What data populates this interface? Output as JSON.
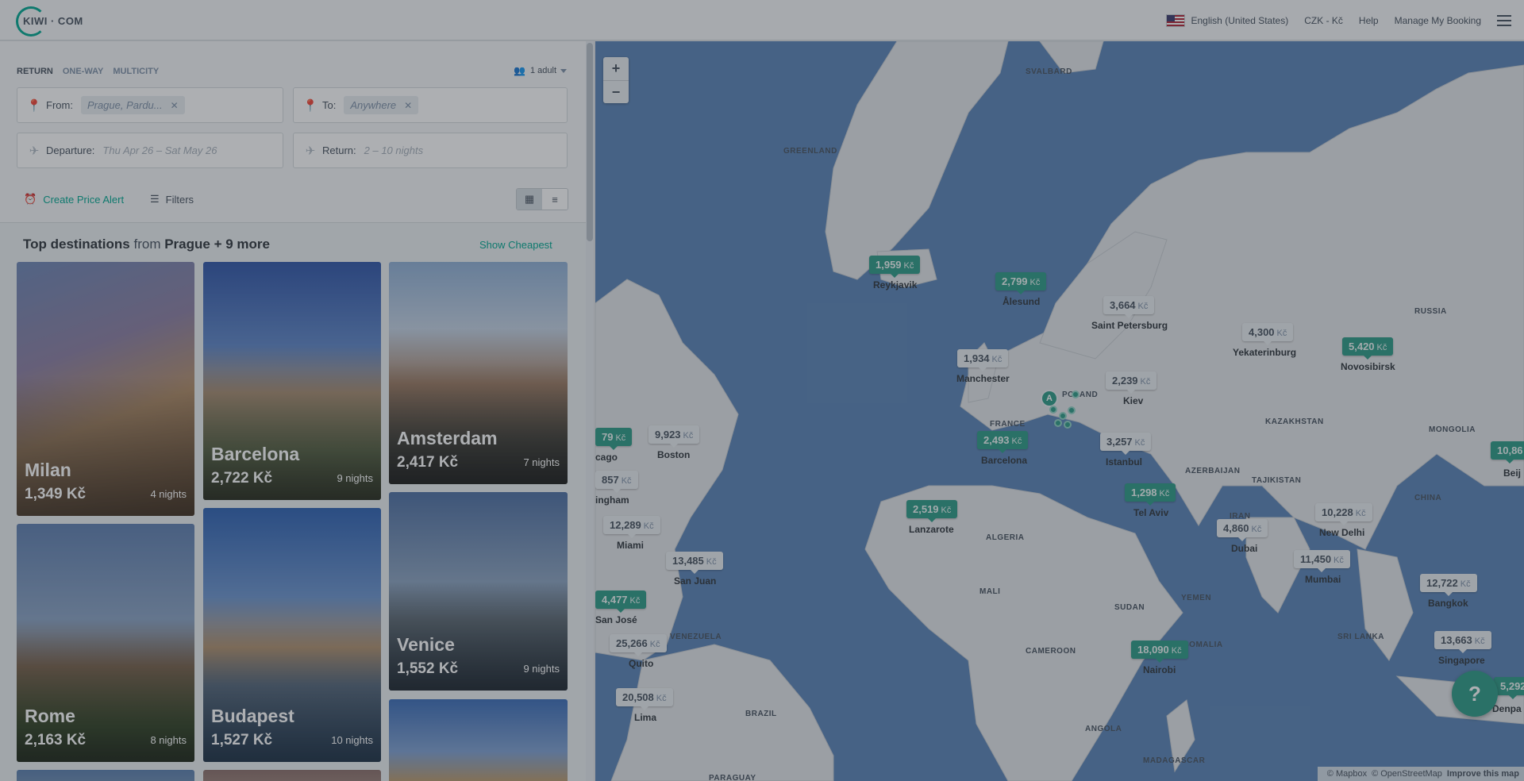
{
  "header": {
    "logo": "KIWI · COM",
    "language": "English (United States)",
    "currency": "CZK - Kč",
    "help": "Help",
    "manage_booking": "Manage My Booking"
  },
  "search": {
    "trip_types": [
      "RETURN",
      "ONE-WAY",
      "MULTICITY"
    ],
    "active_trip_type": "RETURN",
    "passengers": "1 adult",
    "from_label": "From:",
    "from_value": "Prague, Pardu...",
    "to_label": "To:",
    "to_value": "Anywhere",
    "departure_label": "Departure:",
    "departure_value": "Thu Apr 26 – Sat May 26",
    "return_label": "Return:",
    "return_value": "2 – 10 nights",
    "price_alert": "Create Price Alert",
    "filters": "Filters"
  },
  "destinations": {
    "heading_bold": "Top destinations",
    "heading_from": "from",
    "heading_origin": "Prague + 9 more",
    "show_cheapest": "Show Cheapest",
    "cards": [
      {
        "city": "Milan",
        "price": "1,349 Kč",
        "nights": "4 nights"
      },
      {
        "city": "Barcelona",
        "price": "2,722 Kč",
        "nights": "9 nights"
      },
      {
        "city": "Amsterdam",
        "price": "2,417 Kč",
        "nights": "7 nights"
      },
      {
        "city": "Rome",
        "price": "2,163 Kč",
        "nights": "8 nights"
      },
      {
        "city": "Budapest",
        "price": "1,527 Kč",
        "nights": "10 nights"
      },
      {
        "city": "Venice",
        "price": "1,552 Kč",
        "nights": "9 nights"
      }
    ]
  },
  "map": {
    "currency": "Kč",
    "prices": [
      {
        "value": "1,959",
        "city": "Reykjavik",
        "style": "g"
      },
      {
        "value": "2,799",
        "city": "Ålesund",
        "style": "g"
      },
      {
        "value": "3,664",
        "city": "Saint Petersburg",
        "style": "w"
      },
      {
        "value": "4,300",
        "city": "Yekaterinburg",
        "style": "w"
      },
      {
        "value": "5,420",
        "city": "Novosibirsk",
        "style": "g"
      },
      {
        "value": "1,934",
        "city": "Manchester",
        "style": "w"
      },
      {
        "value": "2,239",
        "city": "Kiev",
        "style": "w"
      },
      {
        "value": "2,493",
        "city": "Barcelona",
        "style": "g"
      },
      {
        "value": "3,257",
        "city": "Istanbul",
        "style": "w"
      },
      {
        "value": "1,298",
        "city": "Tel Aviv",
        "style": "g"
      },
      {
        "value": "2,519",
        "city": "Lanzarote",
        "style": "g"
      },
      {
        "value": "9,923",
        "city": "Boston",
        "style": "w"
      },
      {
        "value": "12,289",
        "city": "Miami",
        "style": "w"
      },
      {
        "value": "13,485",
        "city": "San Juan",
        "style": "w"
      },
      {
        "value": "4,477",
        "city": "San José",
        "style": "g"
      },
      {
        "value": "25,266",
        "city": "Quito",
        "style": "w"
      },
      {
        "value": "20,508",
        "city": "Lima",
        "style": "w"
      },
      {
        "value": "18,090",
        "city": "Nairobi",
        "style": "g"
      },
      {
        "value": "4,860",
        "city": "Dubai",
        "style": "w"
      },
      {
        "value": "10,228",
        "city": "New Delhi",
        "style": "w"
      },
      {
        "value": "11,450",
        "city": "Mumbai",
        "style": "w"
      },
      {
        "value": "12,722",
        "city": "Bangkok",
        "style": "w"
      },
      {
        "value": "13,663",
        "city": "Singapore",
        "style": "w"
      },
      {
        "value": "10,86",
        "city": "Beij",
        "style": "g"
      },
      {
        "value": "5,292",
        "city": "Denpa",
        "style": "g"
      },
      {
        "value": "79",
        "city": "",
        "style": "g"
      },
      {
        "value": "857",
        "city": "",
        "style": "w"
      }
    ],
    "partial_cities": [
      "cago",
      "ingham"
    ],
    "regions": [
      "SVALBARD",
      "GREENLAND",
      "RUSSIA",
      "KAZAKHSTAN",
      "MONGOLIA",
      "CHINA",
      "FRANCE",
      "POLAND",
      "AZERBAIJAN",
      "TAJIKISTAN",
      "IRAN",
      "ALGERIA",
      "MALI",
      "SUDAN",
      "YEMEN",
      "SOMALIA",
      "CAMEROON",
      "ANGOLA",
      "MADAGASCAR",
      "SRI LANKA",
      "VENEZUELA",
      "BRAZIL",
      "PARAGUAY"
    ],
    "origin_marker": "A",
    "help": "?",
    "attribution_mapbox": "© Mapbox",
    "attribution_osm": "© OpenStreetMap",
    "improve": "Improve this map"
  }
}
